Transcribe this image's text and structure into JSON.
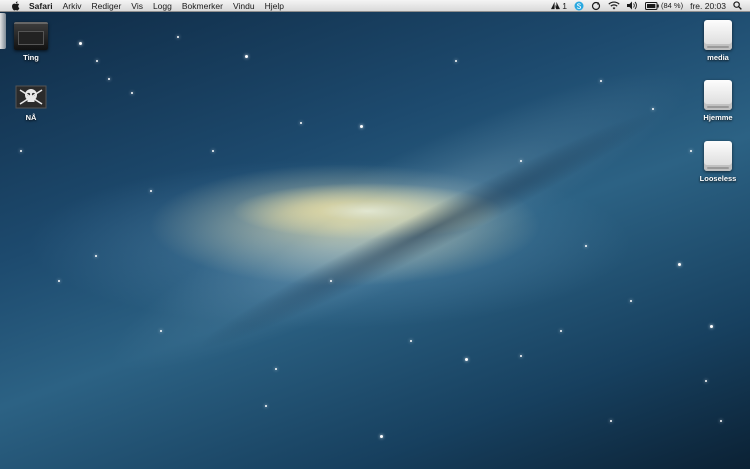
{
  "menubar": {
    "app_name": "Safari",
    "menus": [
      "Arkiv",
      "Rediger",
      "Vis",
      "Logg",
      "Bokmerker",
      "Vindu",
      "Hjelp"
    ],
    "status": {
      "adobe_label": "1",
      "battery_percent": "(84 %)",
      "clock": "fre. 20:03"
    }
  },
  "desktop": {
    "left_icons": [
      {
        "label": "Ting",
        "icon": "folder-icon"
      },
      {
        "label": "NÅ",
        "icon": "skull-icon"
      }
    ],
    "right_icons": [
      {
        "label": "media",
        "icon": "drive-icon"
      },
      {
        "label": "Hjemme",
        "icon": "drive-icon"
      },
      {
        "label": "Looseless",
        "icon": "drive-icon"
      }
    ]
  },
  "colors": {
    "menubar_bg": "#e6e6e6",
    "wallpaper_dark": "#0f2a44",
    "wallpaper_mid": "#2c6284",
    "galaxy_core": "#fffad7"
  }
}
